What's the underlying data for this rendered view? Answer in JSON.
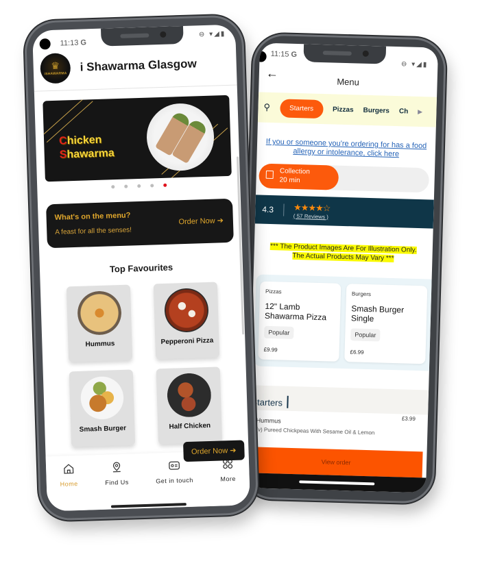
{
  "left_phone": {
    "status": {
      "time": "11:13",
      "carrier_glyph": "G",
      "icons": "⊖ ▾◢▮"
    },
    "header": {
      "logo_alt": "i Shawarma logo",
      "logo_text": "iSHAWARMA",
      "title": "i Shawarma Glasgow"
    },
    "banner": {
      "line1_cap": "C",
      "line1_rest": "hicken",
      "line2_cap": "S",
      "line2_rest": "hawarma",
      "slides": 5,
      "active_slide": 5
    },
    "promo_card": {
      "title": "What's on the menu?",
      "subtitle": "A feast for all the senses!",
      "cta": "Order Now ➔"
    },
    "top_favourites": {
      "title": "Top Favourites",
      "items": [
        {
          "name": "Hummus",
          "image": "hummus"
        },
        {
          "name": "Pepperoni Pizza",
          "image": "pizza"
        },
        {
          "name": "Smash Burger",
          "image": "burger"
        },
        {
          "name": "Half Chicken",
          "image": "chicken"
        }
      ]
    },
    "floating_cta": "Order Now ➔",
    "bottom_nav": [
      {
        "label": "Home",
        "icon": "home-icon",
        "active": true
      },
      {
        "label": "Find Us",
        "icon": "location-pin-icon",
        "active": false
      },
      {
        "label": "Get in touch",
        "icon": "contact-card-icon",
        "active": false
      },
      {
        "label": "More",
        "icon": "grid-icon",
        "active": false
      }
    ]
  },
  "right_phone": {
    "status": {
      "time": "11:15",
      "carrier_glyph": "G",
      "icons": "⊖ ▾◢▮"
    },
    "topbar": {
      "back": "←",
      "title": "Menu"
    },
    "categories": {
      "search_icon": "⚲",
      "items": [
        "Starters",
        "Pizzas",
        "Burgers",
        "Ch"
      ],
      "active": "Starters",
      "more_icon": "▶"
    },
    "allergy_link": "If you or someone you're ordering for has a food allergy or intolerance, click here",
    "collection": {
      "label": "Collection",
      "time": "20 min"
    },
    "rating": {
      "value": "4.3",
      "stars": 4.3,
      "stars_text": "★★★★☆",
      "reviews": "( 57 Reviews )"
    },
    "disclaimer": {
      "line1": "*** The Product Images Are For Illustration Only.",
      "line2": "The Actual Products May Vary ***"
    },
    "popular": [
      {
        "category": "Pizzas",
        "name": "12\" Lamb Shawarma Pizza",
        "tag": "Popular",
        "price": "£9.99"
      },
      {
        "category": "Burgers",
        "name": "Smash Burger Single",
        "tag": "Popular",
        "price": "£6.99"
      }
    ],
    "section": "Starters",
    "items": [
      {
        "name": "Hummus",
        "description": "(v) Pureed Chickpeas With Sesame Oil & Lemon",
        "price": "£3.99"
      }
    ],
    "view_order": "View order"
  },
  "colors": {
    "orange": "#fc5a0c",
    "navy": "#0f3648",
    "gold": "#e0a72c",
    "highlight": "#fafa00",
    "red_dot": "#e0141e"
  }
}
